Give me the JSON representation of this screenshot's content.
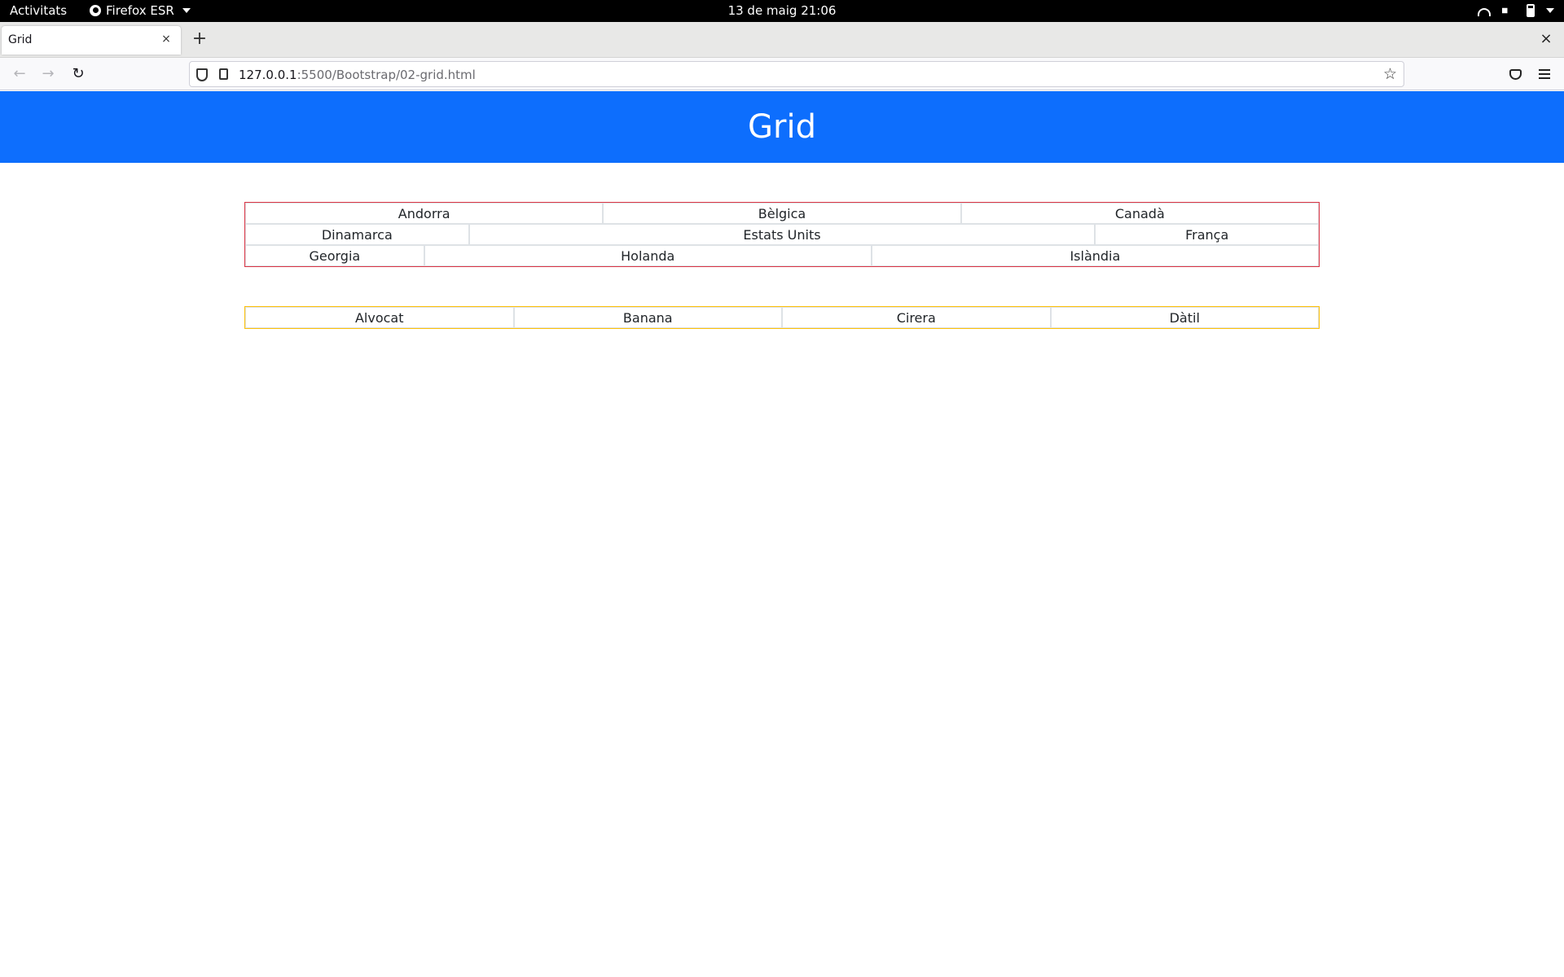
{
  "system_bar": {
    "activities": "Activitats",
    "app_name": "Firefox ESR",
    "clock": "13 de maig  21:06"
  },
  "browser": {
    "tab_title": "Grid",
    "tab_close": "×",
    "new_tab": "+",
    "close_window": "×",
    "url_host": "127.0.0.1",
    "url_rest": ":5500/Bootstrap/02-grid.html",
    "back": "←",
    "forward": "→",
    "reload": "↻",
    "star": "☆"
  },
  "page": {
    "heading": "Grid",
    "countries": {
      "rows": [
        [
          "Andorra",
          "Bèlgica",
          "Canadà"
        ],
        [
          "Dinamarca",
          "Estats Units",
          "França"
        ],
        [
          "Georgia",
          "Holanda",
          "Islàndia"
        ]
      ]
    },
    "fruits": {
      "rows": [
        [
          "Alvocat",
          "Banana",
          "Cirera",
          "Dàtil"
        ]
      ]
    }
  }
}
